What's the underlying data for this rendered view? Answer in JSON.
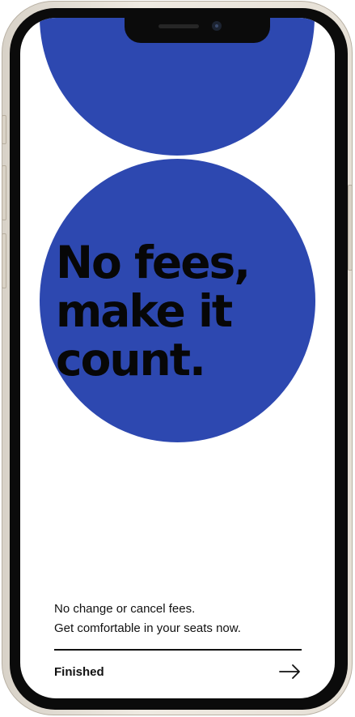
{
  "hero": {
    "headline_lines": [
      "No fees,",
      "make it",
      "count."
    ]
  },
  "body": {
    "description_lines": [
      "No change or cancel fees.",
      "Get comfortable in your seats now."
    ]
  },
  "footer": {
    "action_label": "Finished",
    "action_icon": "arrow-right-icon"
  },
  "colors": {
    "accent": "#2d48b0",
    "text": "#111111",
    "background": "#ffffff",
    "device_frame": "#e6e0d6"
  }
}
